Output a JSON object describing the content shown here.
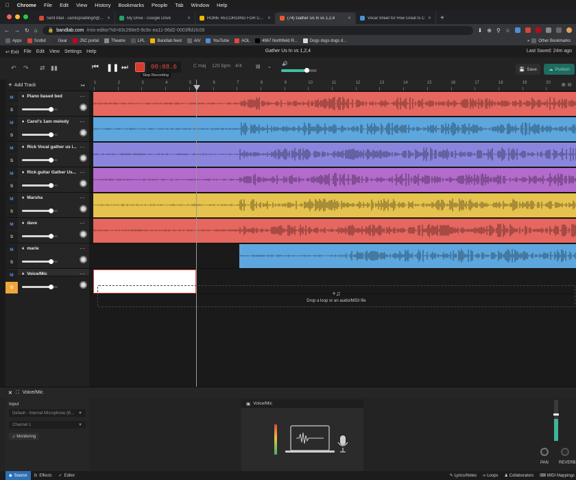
{
  "os_menu": {
    "apple_icon": "apple-icon",
    "app": "Chrome",
    "items": [
      "File",
      "Edit",
      "View",
      "History",
      "Bookmarks",
      "People",
      "Tab",
      "Window",
      "Help"
    ]
  },
  "tabs": [
    {
      "title": "Sent Mail - carolspradlingrt@...",
      "color": "#d44638",
      "active": false
    },
    {
      "title": "My Drive - Google Drive",
      "color": "#1fa463",
      "active": false
    },
    {
      "title": "HOME RECORDING FOR CHUR",
      "color": "#f4b400",
      "active": false
    },
    {
      "title": "(74) Gather Us In vs 1,2,4",
      "color": "#f05a28",
      "active": true
    },
    {
      "title": "Vocal Sheet for How Great Is C",
      "color": "#4a90d9",
      "active": false
    }
  ],
  "address": {
    "host": "bandlab.com",
    "path": "/mix-editor?id=83c266e5-9c9c-ea11-96d2-0003ffd1fc09"
  },
  "bookmarks": [
    "Apps",
    "Scribd",
    "Gear",
    "JSC portal",
    "Theatre",
    "LPL",
    "Bandlab feed",
    "AIV",
    "YouTube",
    "AOL",
    "4967 Northfield R...",
    "Dogs dogs dogs d..."
  ],
  "bookmarks_other": "Other Bookmarks",
  "bandlab_menu": {
    "exit": "Exit",
    "items": [
      "File",
      "Edit",
      "View",
      "Settings",
      "Help"
    ]
  },
  "project_title": "Gather Us In vs 1,2,4",
  "last_saved": "Last Saved: 24m ago",
  "transport": {
    "time": "00:08.6",
    "stop_recording": "Stop Recording",
    "key": "C maj",
    "tempo": "120",
    "tempo_unit": "bpm",
    "meter": "4/4",
    "master_volume": 0.72,
    "save_label": "Save",
    "publish_label": "Publish"
  },
  "add_track": "Add Track",
  "ruler": [
    "1",
    "2",
    "3",
    "4",
    "5",
    "6",
    "7",
    "8",
    "9",
    "10",
    "11",
    "12",
    "13",
    "14",
    "15",
    "16",
    "17",
    "18",
    "19",
    "20"
  ],
  "tracks": [
    {
      "name": "Piano based bed",
      "color": "#e5675f",
      "volume": 0.8,
      "region_start": 0.0,
      "solo": false
    },
    {
      "name": "Carol's 1am melody",
      "color": "#5da6de",
      "volume": 0.8,
      "region_start": 0.0,
      "solo": false
    },
    {
      "name": "Rick Vocal gather us i...",
      "color": "#8a86de",
      "volume": 0.8,
      "region_start": 0.0,
      "solo": false
    },
    {
      "name": "Rick guitar Gather Us...",
      "color": "#b36bcc",
      "volume": 0.8,
      "region_start": 0.0,
      "solo": false
    },
    {
      "name": "Marsha",
      "color": "#e6c24e",
      "volume": 0.8,
      "region_start": 0.0,
      "solo": false
    },
    {
      "name": "dave",
      "color": "#e5675f",
      "volume": 0.8,
      "region_start": 0.0,
      "solo": false
    },
    {
      "name": "marie",
      "color": "#5da6de",
      "volume": 0.8,
      "region_start": 0.3,
      "solo": false
    },
    {
      "name": "Voice/Mic",
      "color": "#ffffff",
      "volume": 0.8,
      "region_start": 0.0,
      "solo": true
    }
  ],
  "drop_zone": "Drop a loop or an audio/MIDI file",
  "bottom": {
    "title": "Voice/Mic",
    "input_label": "Input",
    "input_device": "Default - Internal Microphone (B...",
    "channel": "Channel 1",
    "monitoring": "Monitoring",
    "card_title": "Voice/Mic",
    "pan_label": "PAN",
    "reverb_label": "REVERB"
  },
  "footer": {
    "tabs": [
      "Source",
      "Effects",
      "Editor"
    ],
    "right": [
      "Lyrics/Notes",
      "Loops",
      "Collaborators",
      "MIDI Mappings"
    ]
  }
}
